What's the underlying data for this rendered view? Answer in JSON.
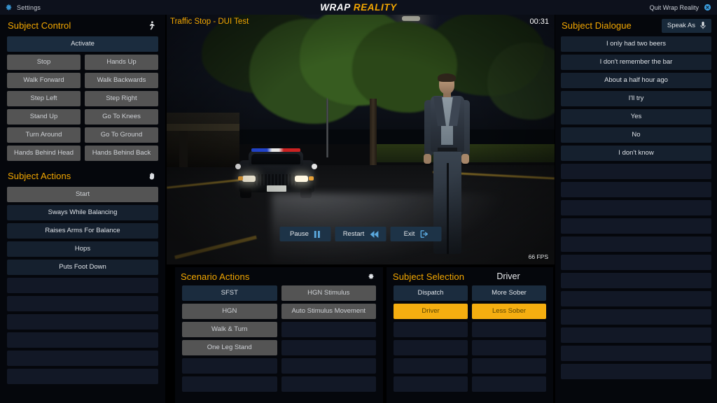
{
  "topbar": {
    "settings_label": "Settings",
    "settings_icon": "gear-icon",
    "logo_primary": "WRAP",
    "logo_secondary": "REALITY",
    "quit_label": "Quit Wrap Reality",
    "quit_icon": "close-circle-icon"
  },
  "viewport": {
    "scenario_title": "Traffic Stop - DUI Test",
    "timer": "00:31",
    "fps": "66 FPS",
    "transport": [
      {
        "label": "Pause",
        "icon": "pause-icon"
      },
      {
        "label": "Restart",
        "icon": "rewind-icon"
      },
      {
        "label": "Exit",
        "icon": "exit-icon"
      }
    ]
  },
  "subject_control": {
    "title": "Subject Control",
    "icon": "running-person-icon",
    "activate": "Activate",
    "buttons": [
      [
        "Stop",
        "Hands Up"
      ],
      [
        "Walk Forward",
        "Walk Backwards"
      ],
      [
        "Step Left",
        "Step Right"
      ],
      [
        "Stand Up",
        "Go To Knees"
      ],
      [
        "Turn Around",
        "Go To Ground"
      ],
      [
        "Hands Behind Head",
        "Hands Behind Back"
      ]
    ]
  },
  "subject_actions": {
    "title": "Subject Actions",
    "icon": "hand-icon",
    "items": [
      {
        "label": "Start",
        "state": "gray"
      },
      {
        "label": "Sways While Balancing",
        "state": "navy"
      },
      {
        "label": "Raises Arms For Balance",
        "state": "navy"
      },
      {
        "label": "Hops",
        "state": "navy"
      },
      {
        "label": "Puts Foot Down",
        "state": "navy"
      }
    ],
    "empty_rows": 6
  },
  "scenario_actions": {
    "title": "Scenario Actions",
    "icon": "gear-icon",
    "rows": [
      [
        {
          "label": "SFST",
          "state": "navy-selected"
        },
        {
          "label": "HGN Stimulus",
          "state": "gray"
        }
      ],
      [
        {
          "label": "HGN",
          "state": "gray"
        },
        {
          "label": "Auto Stimulus Movement",
          "state": "gray"
        }
      ],
      [
        {
          "label": "Walk & Turn",
          "state": "gray"
        },
        {
          "label": "",
          "state": "empty"
        }
      ],
      [
        {
          "label": "One Leg Stand",
          "state": "gray"
        },
        {
          "label": "",
          "state": "empty"
        }
      ],
      [
        {
          "label": "",
          "state": "empty"
        },
        {
          "label": "",
          "state": "empty"
        }
      ],
      [
        {
          "label": "",
          "state": "empty"
        },
        {
          "label": "",
          "state": "empty"
        }
      ]
    ]
  },
  "subject_selection": {
    "title": "Subject Selection",
    "subtitle": "Driver",
    "rows": [
      [
        {
          "label": "Dispatch",
          "state": "navy"
        },
        {
          "label": "More Sober",
          "state": "navy"
        }
      ],
      [
        {
          "label": "Driver",
          "state": "amber"
        },
        {
          "label": "Less Sober",
          "state": "amber"
        }
      ],
      [
        {
          "label": "",
          "state": "empty"
        },
        {
          "label": "",
          "state": "empty"
        }
      ],
      [
        {
          "label": "",
          "state": "empty"
        },
        {
          "label": "",
          "state": "empty"
        }
      ],
      [
        {
          "label": "",
          "state": "empty"
        },
        {
          "label": "",
          "state": "empty"
        }
      ],
      [
        {
          "label": "",
          "state": "empty"
        },
        {
          "label": "",
          "state": "empty"
        }
      ]
    ]
  },
  "subject_dialogue": {
    "title": "Subject Dialogue",
    "speak_as_label": "Speak As",
    "speak_as_icon": "microphone-icon",
    "items": [
      "I only had two beers",
      "I don't remember the bar",
      "About a half hour ago",
      "I'll try",
      "Yes",
      "No",
      "I don't know"
    ],
    "empty_rows": 13
  },
  "colors": {
    "accent": "#f5a800",
    "panel_bg": "#05070c",
    "navy_btn": "#1b2c3e",
    "gray_btn": "#545454",
    "amber_btn": "#f5ae10",
    "topbar_bg": "#0d111c",
    "empty_row": "#121826",
    "icon_blue": "#3b9ddd"
  }
}
